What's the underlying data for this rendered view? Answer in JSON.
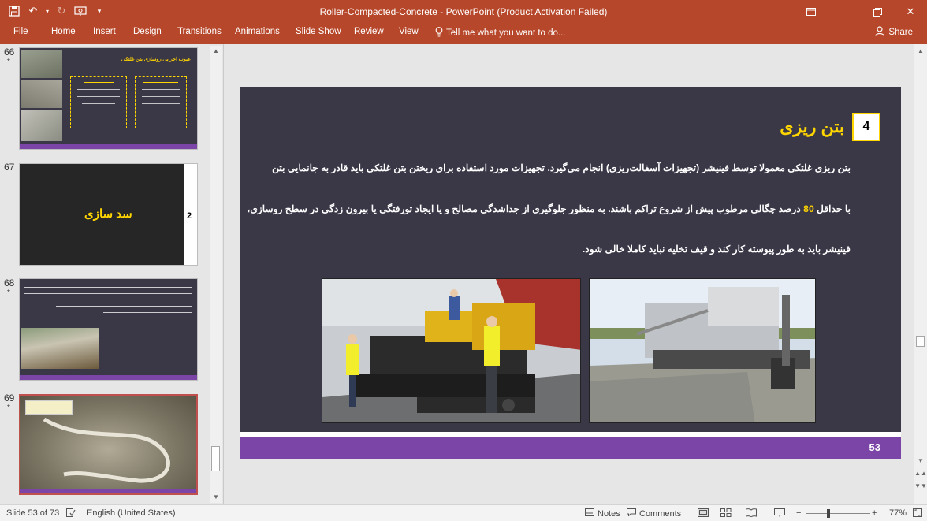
{
  "titlebar": {
    "title": "Roller-Compacted-Concrete - PowerPoint (Product Activation Failed)",
    "qat": {
      "save_icon": "save-icon",
      "undo_icon": "undo-icon",
      "redo_icon": "redo-icon",
      "present_icon": "present-from-beginning-icon",
      "customize_icon": "customize-icon"
    },
    "controls": [
      "ribbon-display-icon",
      "minimize-icon",
      "restore-icon",
      "close-icon"
    ]
  },
  "ribbon": {
    "tabs": [
      "File",
      "Home",
      "Insert",
      "Design",
      "Transitions",
      "Animations",
      "Slide Show",
      "Review",
      "View"
    ],
    "tell_me": "Tell me what you want to do...",
    "share": "Share"
  },
  "thumbnails": [
    {
      "number": "66",
      "star": "*",
      "title": "عیوب اجرایی روسازی بتن غلتکی"
    },
    {
      "number": "67",
      "star": "*",
      "title": "سد سازی",
      "side_number": "2"
    },
    {
      "number": "68",
      "star": "*"
    },
    {
      "number": "69",
      "star": "*"
    }
  ],
  "slide": {
    "section_number": "4",
    "heading": "بتن ریزی",
    "line1": "بتن ریزی غلتکی معمولا توسط فینیشر (تجهیزات آسفالت‌ریزی) انجام می‌گیرد. تجهیزات مورد استفاده برای ریختن بتن غلتکی باید قادر به جانمایی بتن",
    "line2_prefix": "با حداقل",
    "line2_highlight": "80",
    "line2_suffix": "درصد چگالی مرطوب پیش از شروع تراکم باشند. به منظور جلوگیری از جداشدگی مصالح و یا ایجاد تورفتگی یا بیرون زدگی در سطح روسازی،",
    "line3": "فینیشر باید به طور پیوسته کار کند و قیف تخلیه نباید کاملا خالی شود.",
    "slide_number": "53",
    "colors": {
      "background": "#3a3747",
      "accent": "#ffd500",
      "footer": "#7a45a6"
    }
  },
  "statusbar": {
    "slide_info": "Slide 53 of 73",
    "language": "English (United States)",
    "notes": "Notes",
    "comments": "Comments",
    "zoom": "77%"
  }
}
